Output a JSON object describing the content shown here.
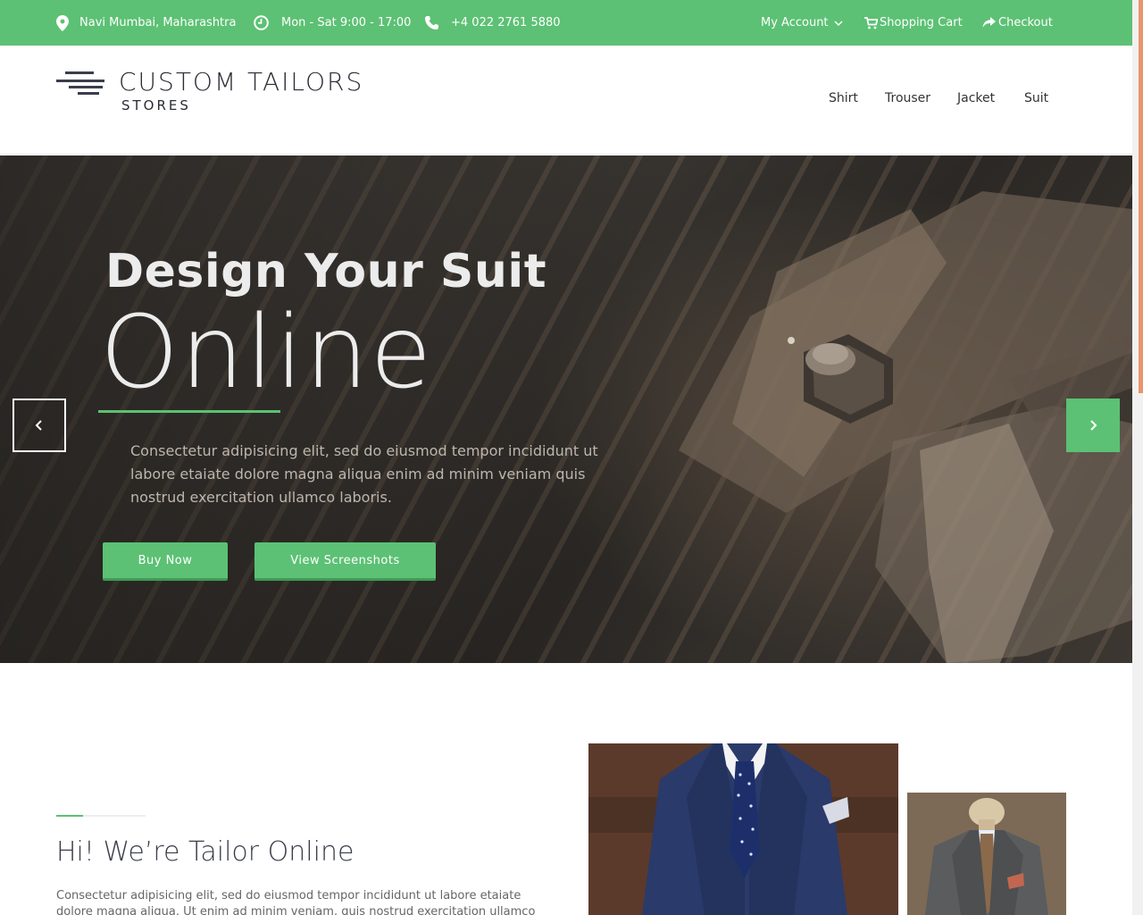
{
  "topbar": {
    "location": "Navi Mumbai, Maharashtra",
    "hours": "Mon - Sat 9:00 - 17:00",
    "phone": "+4 022 2761 5880",
    "my_account": "My Account",
    "cart": "Shopping Cart",
    "checkout": "Checkout"
  },
  "header": {
    "logo_title": "CUSTOM TAILORS",
    "logo_sub": "STORES",
    "nav": [
      "Shirt",
      "Trouser",
      "Jacket",
      "Suit"
    ]
  },
  "hero": {
    "title": "Design Your Suit",
    "big": "Online",
    "text": "Consectetur adipisicing elit, sed do eiusmod tempor incididunt ut labore etaiate dolore magna aliqua enim ad minim veniam quis nostrud exercitation ullamco laboris.",
    "btn_buy": "Buy Now",
    "btn_view": "View Screenshots"
  },
  "about": {
    "title": "Hi! We’re Tailor Online",
    "text": "Consectetur adipisicing elit, sed do eiusmod tempor incididunt ut labore etaiate dolore magna aliqua. Ut enim ad minim veniam, quis nostrud exercitation ullamco laboris nisi ut"
  },
  "colors": {
    "accent": "#5cc174",
    "dark": "#3a3d4a",
    "scroll": "#e8956a"
  }
}
